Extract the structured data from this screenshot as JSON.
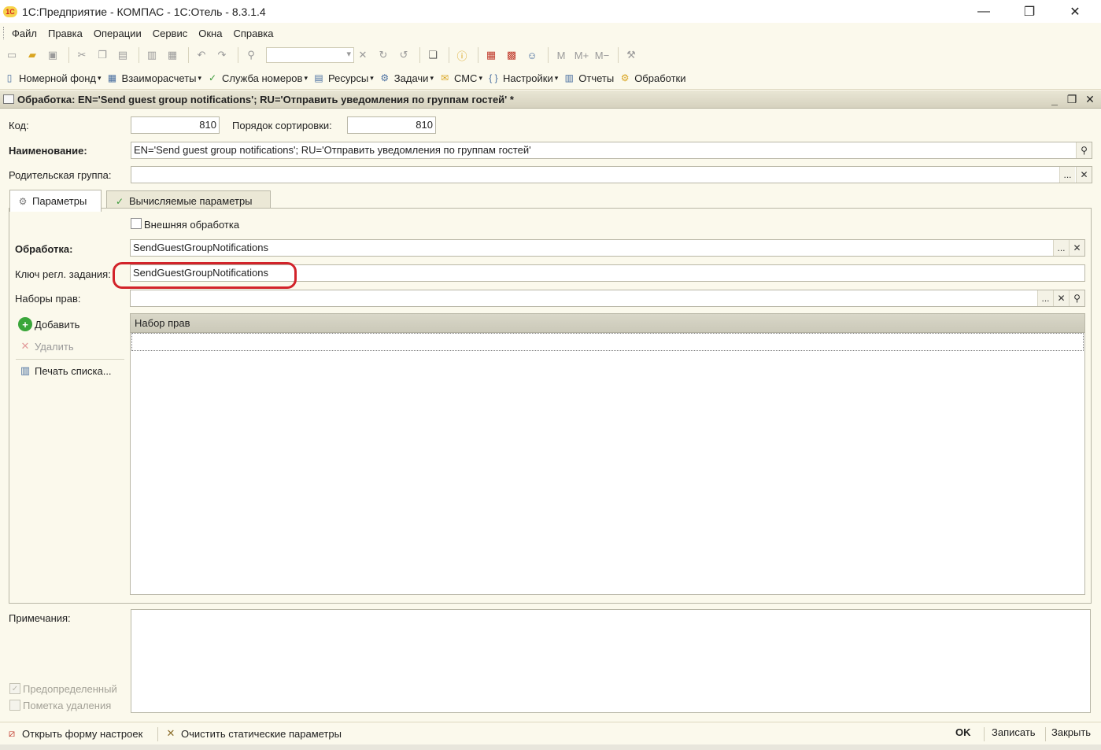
{
  "window": {
    "title": "1С:Предприятие - КОМПАС - 1С:Отель - 8.3.1.4",
    "minimize": "—",
    "maximize": "❐",
    "close": "✕"
  },
  "menu": [
    "Файл",
    "Правка",
    "Операции",
    "Сервис",
    "Окна",
    "Справка"
  ],
  "toolbar_icons": [
    "new-doc",
    "open-folder",
    "save",
    "cut",
    "copy",
    "paste",
    "print",
    "preview",
    "undo",
    "redo",
    "search",
    "info",
    "calendar-grid",
    "calendar",
    "users",
    "memory-m",
    "memory-m-plus",
    "memory-m-minus",
    "tools"
  ],
  "toolbar_text": {
    "m": "M",
    "mplus": "M+",
    "mminus": "M−"
  },
  "sections": [
    {
      "label": "Номерной фонд",
      "arrow": "▾"
    },
    {
      "label": "Взаиморасчеты",
      "arrow": "▾"
    },
    {
      "label": "Служба номеров",
      "arrow": "▾"
    },
    {
      "label": "Ресурсы",
      "arrow": "▾"
    },
    {
      "label": "Задачи",
      "arrow": "▾"
    },
    {
      "label": "СМС",
      "arrow": "▾"
    },
    {
      "label": "Настройки",
      "arrow": "▾"
    },
    {
      "label": "Отчеты",
      "arrow": ""
    },
    {
      "label": "Обработки",
      "arrow": ""
    }
  ],
  "form": {
    "title": "Обработка: EN='Send guest group notifications'; RU='Отправить уведомления по группам гостей' *",
    "code_label": "Код:",
    "code_value": "810",
    "sort_label": "Порядок сортировки:",
    "sort_value": "810",
    "name_label": "Наименование:",
    "name_value": "EN='Send guest group notifications'; RU='Отправить уведомления по группам гостей'",
    "parent_label": "Родительская группа:",
    "parent_value": "",
    "tabs": [
      "Параметры",
      "Вычисляемые параметры"
    ],
    "external_label": "Внешняя обработка",
    "processing_label": "Обработка:",
    "processing_value": "SendGuestGroupNotifications",
    "key_label": "Ключ регл. задания:",
    "key_value": "SendGuestGroupNotifications",
    "rights_label": "Наборы прав:",
    "rights_value": "",
    "add_label": "Добавить",
    "delete_label": "Удалить",
    "print_label": "Печать списка...",
    "table_header": "Набор прав",
    "notes_label": "Примечания:",
    "predefined_label": "Предопределенный",
    "deletion_label": "Пометка удаления",
    "ellipsis": "...",
    "clear": "✕"
  },
  "bottom": {
    "open_settings": "Открыть форму настроек",
    "clear_static": "Очистить статические параметры",
    "ok": "OK",
    "save": "Записать",
    "close": "Закрыть"
  }
}
